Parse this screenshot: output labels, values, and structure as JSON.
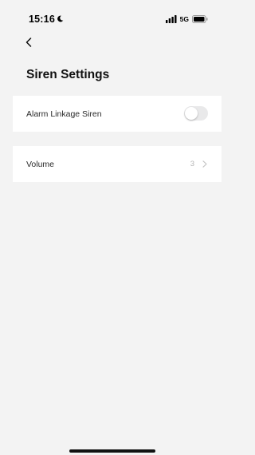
{
  "status_bar": {
    "time": "15:16",
    "network": "5G"
  },
  "header": {
    "title": "Siren Settings"
  },
  "settings": {
    "alarm_linkage": {
      "label": "Alarm Linkage Siren",
      "enabled": false
    },
    "volume": {
      "label": "Volume",
      "value": "3"
    }
  },
  "colors": {
    "background": "#f3f3f3",
    "card": "#ffffff",
    "toggle_off": "#e9e9ea",
    "secondary_text": "#b5b5b5"
  }
}
